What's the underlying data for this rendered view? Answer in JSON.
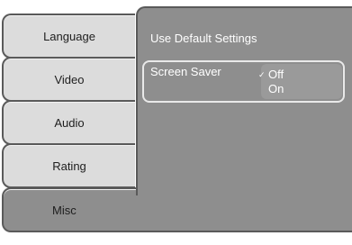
{
  "tabs": [
    {
      "label": "Language"
    },
    {
      "label": "Video"
    },
    {
      "label": "Audio"
    },
    {
      "label": "Rating"
    },
    {
      "label": "Misc"
    }
  ],
  "panel": {
    "title": "Use Default Settings",
    "setting": {
      "label": "Screen Saver",
      "options": [
        "Off",
        "On"
      ],
      "selected": "Off"
    }
  },
  "colors": {
    "tab_bg": "#dcdcdc",
    "active_bg": "#8e8e8e",
    "border": "#5a5a5a"
  },
  "icons": {
    "check": "checkmark-icon"
  }
}
